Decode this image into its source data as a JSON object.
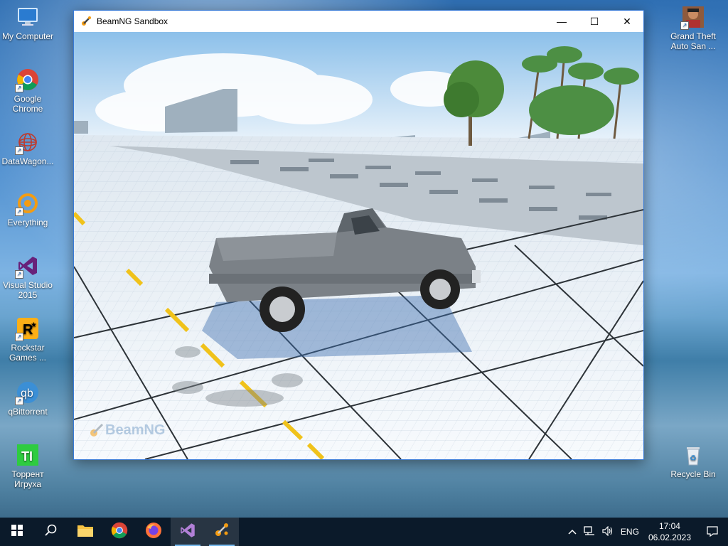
{
  "desktop": {
    "icons_left": [
      {
        "label": "My Computer",
        "icon": "computer-icon"
      },
      {
        "label": "Google Chrome",
        "icon": "chrome-icon"
      },
      {
        "label": "DataWagon...",
        "icon": "datawagon-icon"
      },
      {
        "label": "Everything",
        "icon": "everything-icon"
      },
      {
        "label": "Visual Studio 2015",
        "icon": "visual-studio-icon"
      },
      {
        "label": "Rockstar Games ...",
        "icon": "rockstar-icon"
      },
      {
        "label": "qBittorrent",
        "icon": "qbittorrent-icon"
      },
      {
        "label": "Торрент Игруха",
        "icon": "torrent-igruha-icon"
      }
    ],
    "icons_right": [
      {
        "label": "Grand Theft Auto San ...",
        "icon": "gta-san-andreas-icon"
      },
      {
        "label": "Recycle Bin",
        "icon": "recycle-bin-icon"
      }
    ]
  },
  "window": {
    "title": "BeamNG Sandbox",
    "icon": "beamng-icon",
    "controls": {
      "minimize": "—",
      "maximize": "☐",
      "close": "✕"
    },
    "watermark": "BeamNG"
  },
  "taskbar": {
    "apps": [
      {
        "name": "start",
        "icon": "windows-start-icon"
      },
      {
        "name": "search",
        "icon": "search-icon"
      },
      {
        "name": "file-explorer",
        "icon": "folder-icon"
      },
      {
        "name": "chrome",
        "icon": "chrome-icon"
      },
      {
        "name": "firefox",
        "icon": "firefox-icon"
      },
      {
        "name": "visual-studio",
        "icon": "visual-studio-icon"
      },
      {
        "name": "beamng",
        "icon": "beamng-icon"
      }
    ],
    "tray": {
      "language": "ENG",
      "time": "17:04",
      "date": "06.02.2023"
    }
  },
  "colors": {
    "taskbar": "#0b1a2a",
    "accent": "#76b9ed",
    "window_border": "#3a7bd5",
    "sky": "#bcd9f2",
    "floor": "#f2f6fa",
    "truck": "#7b8187",
    "road_line": "#f0c21a"
  }
}
